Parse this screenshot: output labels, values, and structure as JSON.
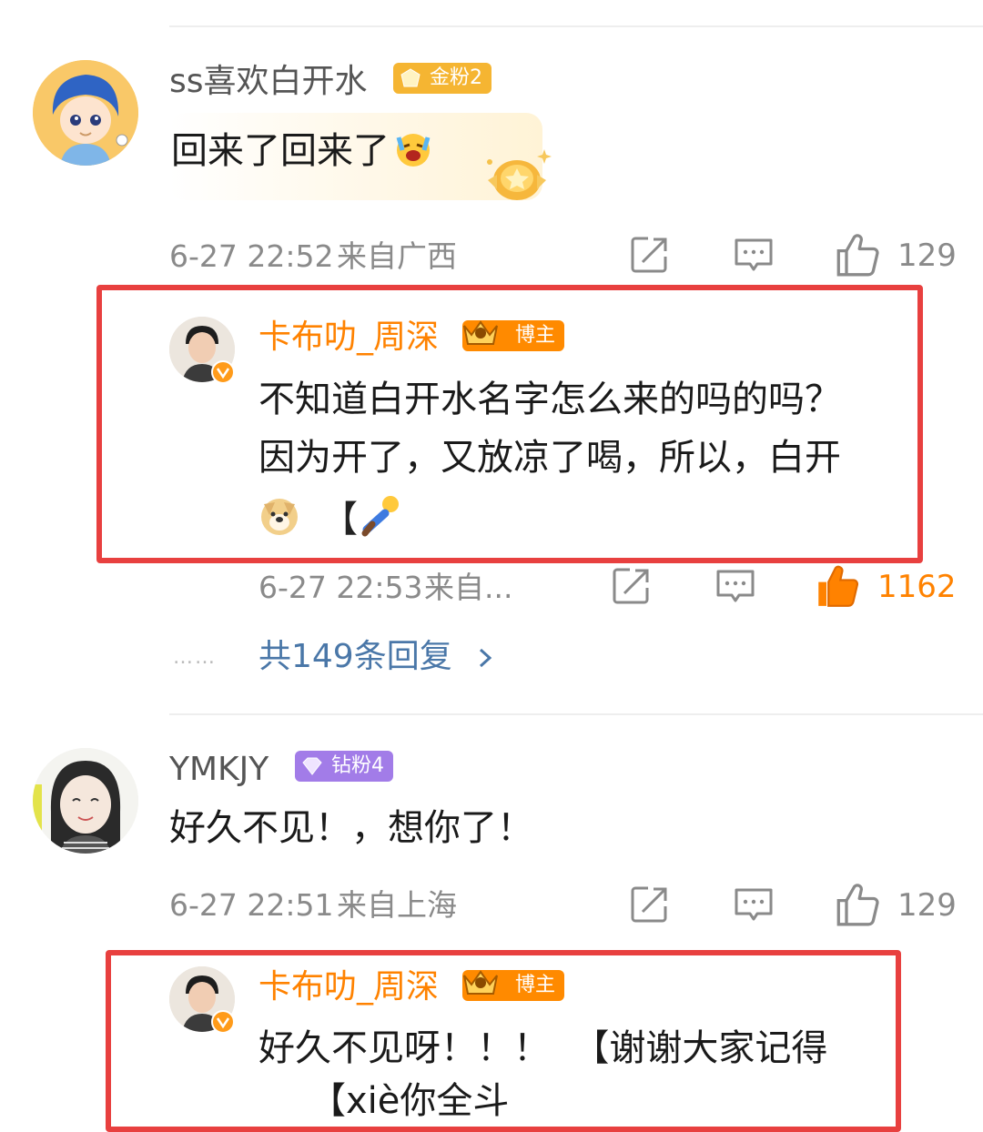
{
  "comments": [
    {
      "username": "ss喜欢白开水",
      "badge": "金粉2",
      "text": "回来了回来了",
      "time": "6-27 22:52",
      "location": "来自广西",
      "likes": "129",
      "reply": {
        "username": "卡布叻_周深",
        "badge": "博主",
        "line1": "不知道白开水名字怎么来的吗的吗？",
        "line2": "因为开了，又放凉了喝，所以，白开",
        "line3_bracket": "【",
        "time": "6-27 22:53",
        "location": "来自...",
        "likes": "1162"
      },
      "more_replies": "共149条回复",
      "more_dots": "……"
    },
    {
      "username": "YMKJY",
      "badge": "钻粉4",
      "text": "好久不见！，想你了！",
      "time": "6-27 22:51",
      "location": "来自上海",
      "likes": "129",
      "reply": {
        "username": "卡布叻_周深",
        "badge": "博主",
        "line1": "好久不见呀！！！  【谢谢大家记得",
        "line2": "【xiè你全斗"
      }
    }
  ],
  "colors": {
    "author_name": "#ff8200",
    "highlight_box": "#e8403f",
    "link": "#4a77a8",
    "liked": "#ff8200",
    "gold_badge": "#f5b532",
    "diamond_badge": "#a27ce8",
    "host_badge": "#ff8a00"
  },
  "icons": [
    "repost-icon",
    "comment-icon",
    "like-icon",
    "verified-icon",
    "crown-icon",
    "diamond-icon",
    "gold-fan-icon"
  ]
}
